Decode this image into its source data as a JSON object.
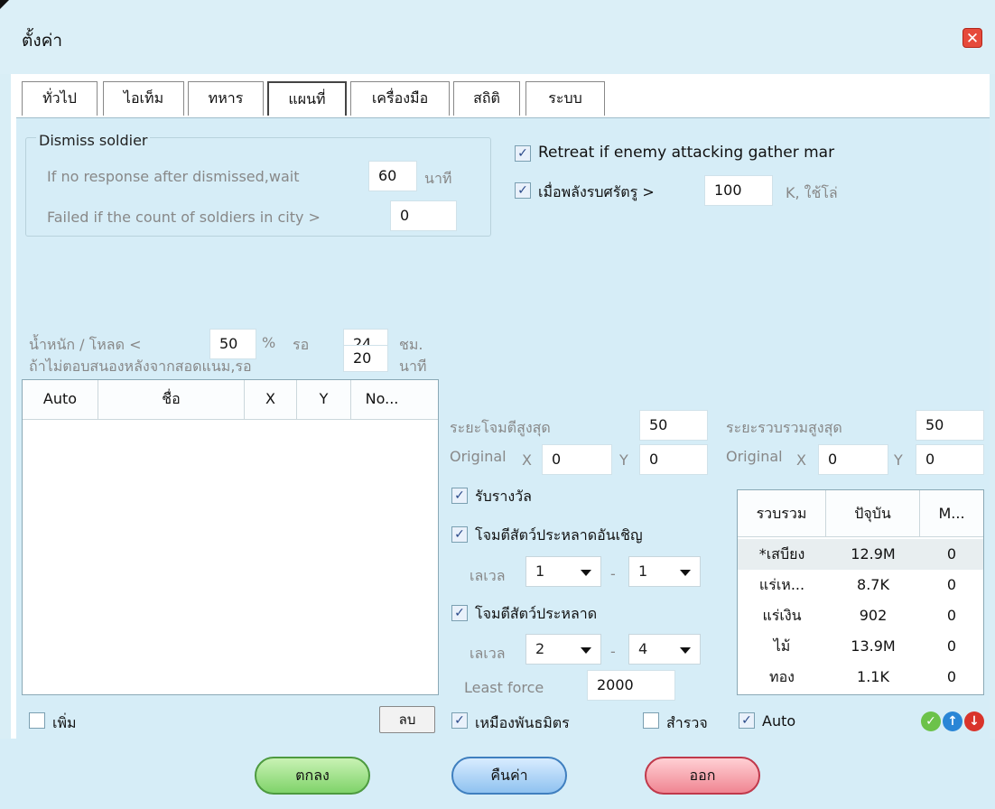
{
  "window": {
    "title": "ตั้งค่า",
    "close_icon": "close-icon"
  },
  "tabs": [
    {
      "label": "ทั่วไป"
    },
    {
      "label": "ไอเท็ม"
    },
    {
      "label": "ทหาร"
    },
    {
      "label": "แผนที่"
    },
    {
      "label": "เครื่องมือ"
    },
    {
      "label": "สถิติ"
    },
    {
      "label": "ระบบ"
    }
  ],
  "active_tab": "แผนที่",
  "dismiss": {
    "title": "Dismiss soldier",
    "wait_label": "If no response after dismissed,wait",
    "wait_value": "60",
    "wait_unit": "นาที",
    "count_label": "Failed if the count of soldiers in city >",
    "count_value": "0"
  },
  "retreat": {
    "label": "Retreat if enemy attacking gather mar",
    "checked": true
  },
  "enemy_force": {
    "label": "เมื่อพลังรบศรัตรู >",
    "value": "100",
    "unit": "K, ใช้โล่",
    "checked": true
  },
  "weight": {
    "label": "น้ำหนัก / โหลด <",
    "percent_value": "50",
    "percent_unit": "%",
    "wait_label": "รอ",
    "hours_value": "24",
    "hours_unit": "ชม."
  },
  "no_response": {
    "label": "ถ้าไม่ตอบสนองหลังจากสอดแนม,รอ",
    "value": "20",
    "unit": "นาที"
  },
  "list": {
    "headers": [
      "Auto",
      "ชื่อ",
      "X",
      "Y",
      "No..."
    ],
    "add_label": "เพิ่ม",
    "delete_label": "ลบ"
  },
  "attack_range": {
    "label": "ระยะโจมตีสูงสุด",
    "value": "50",
    "original_label": "Original",
    "x_label": "X",
    "x_value": "0",
    "y_label": "Y",
    "y_value": "0"
  },
  "gather_range": {
    "label": "ระยะรวบรวมสูงสุด",
    "value": "50",
    "original_label": "Original",
    "x_label": "X",
    "x_value": "0",
    "y_label": "Y",
    "y_value": "0"
  },
  "reward": {
    "label": "รับรางวัล",
    "checked": true
  },
  "invite_monster": {
    "label": "โจมตีสัตว์ประหลาดอันเชิญ",
    "checked": true,
    "level_label": "เลเวล",
    "from": "1",
    "to": "1",
    "dash": "-"
  },
  "monster": {
    "label": "โจมตีสัตว์ประหลาด",
    "checked": true,
    "level_label": "เลเวล",
    "from": "2",
    "to": "4",
    "dash": "-",
    "least_force_label": "Least force",
    "least_force_value": "2000"
  },
  "resources": {
    "headers": [
      "รวบรวม",
      "ปัจุบัน",
      "M..."
    ],
    "rows": [
      {
        "name": "*เสบียง",
        "current": "12.9M",
        "m": "0"
      },
      {
        "name": "แร่เห...",
        "current": "8.7K",
        "m": "0"
      },
      {
        "name": "แร่เงิน",
        "current": "902",
        "m": "0"
      },
      {
        "name": "ไม้",
        "current": "13.9M",
        "m": "0"
      },
      {
        "name": "ทอง",
        "current": "1.1K",
        "m": "0"
      }
    ]
  },
  "bottom_options": {
    "alliance": {
      "label": "เหมืองพันธมิตร",
      "checked": true
    },
    "scout": {
      "label": "สำรวจ",
      "checked": false
    },
    "auto": {
      "label": "Auto",
      "checked": true
    }
  },
  "footer": {
    "ok": "ตกลง",
    "reset": "คืนค่า",
    "exit": "ออก"
  },
  "colors": {
    "panel": "#d6edf7",
    "ok_green": "#7fd36a",
    "reset_blue": "#8fc2f0",
    "exit_red": "#f08592"
  }
}
